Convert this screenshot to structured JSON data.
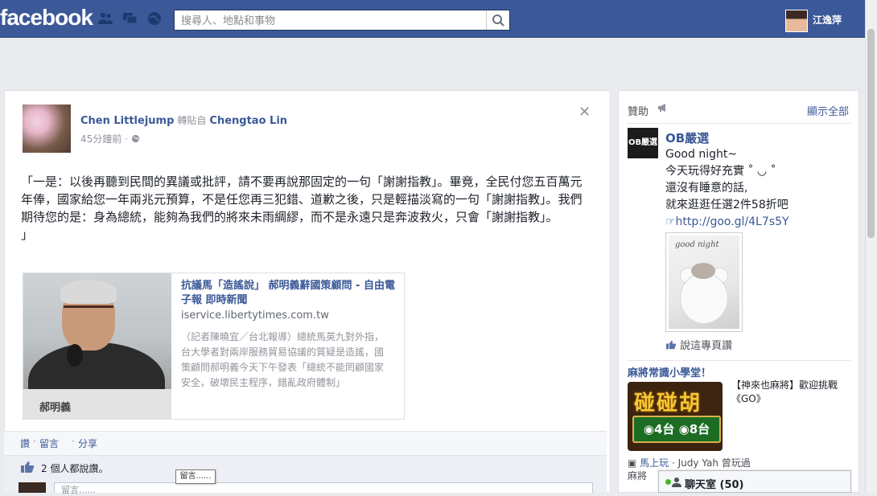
{
  "topbar": {
    "logo": "facebook",
    "search_placeholder": "搜尋人、地點和事物",
    "username": "江逸萍",
    "jewels": [
      "friend-requests-icon",
      "messages-icon",
      "notifications-icon"
    ]
  },
  "post": {
    "author": "Chen Littlejump",
    "via_text": "轉貼自",
    "source_author": "Chengtao Lin",
    "time": "45分鐘前",
    "privacy_icon": "globe-icon",
    "body": "「一是：以後再聽到民間的異議或批評，請不要再說那固定的一句「謝謝指教」。畢竟，全民付您五百萬元年俸，國家給您一年兩兆元預算，不是任您再三犯錯、道歉之後，只是輕描淡寫的一句「謝謝指教」。我們期待您的是：身為總統，能夠為我們的將來未雨綢繆，而不是永遠只是奔波救火，只會「謝謝指教」。",
    "body_close": "」",
    "link": {
      "title": "抗議馬「造謠說」 郝明義辭國策顧問 - 自由電子報 即時新聞",
      "domain": "iservice.libertytimes.com.tw",
      "description": "（記者陳曉宜／台北報導）總統馬英九對外指，台大學者對兩岸服務貿易協議的質疑是造謠，國策顧問郝明義今天下午發表「總統不能罔顧國家安全，破壞民主程序，錯亂政府體制」",
      "image_caption": "郝明義"
    },
    "actions": {
      "like": "讚",
      "comment": "留言",
      "share": "分享",
      "separator": "·"
    },
    "likes_text": "2 個人都說讚。",
    "comment_placeholder": "留言......",
    "tooltip": "留言......"
  },
  "sidebar": {
    "sponsored_label": "贊助",
    "see_all": "顯示全部",
    "ad1": {
      "logo_text": "OB嚴選",
      "title": "OB嚴選",
      "lines": [
        "Good night~",
        "今天玩得好充實 ˚ ◡ ˚",
        "還沒有睡意的話,",
        "就來逛逛任選2件58折吧"
      ],
      "link": "☞http://goo.gl/4L7s5Y",
      "photo_caption": "good night",
      "like_page": "說這專頁讚"
    },
    "ad2": {
      "title": "麻將常識小學堂！",
      "game_brand": "碰碰胡",
      "game_board": "◉4台 ◉8台",
      "description": "【神來也麻將】歡迎挑戰《GO》",
      "play_line_link": "馬上玩",
      "play_line_rest": " · Judy Yah 曾玩過",
      "second_line": "麻將"
    }
  },
  "chat": {
    "label": "聊天室 (50)"
  },
  "colors": {
    "brand": "#3b5998",
    "link": "#3b5998",
    "online": "#42b72a"
  }
}
